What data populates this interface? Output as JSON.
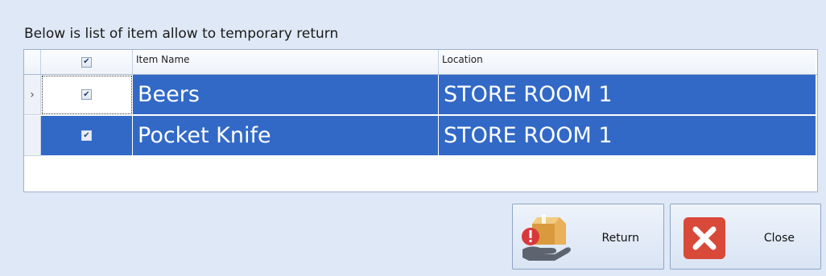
{
  "caption": "Below is list of item allow to temporary return",
  "grid": {
    "columns": [
      "Item Name",
      "Location"
    ],
    "rows": [
      {
        "checked": true,
        "item_name": "Beers",
        "location": "STORE ROOM 1",
        "current": true
      },
      {
        "checked": true,
        "item_name": "Pocket Knife",
        "location": "STORE ROOM 1",
        "current": false
      }
    ],
    "row_indicator": "›",
    "selection_color": "#3269c7"
  },
  "buttons": {
    "return_label": "Return",
    "close_label": "Close"
  },
  "icons": {
    "return": "hand-box-warning-icon",
    "close": "close-x-icon"
  }
}
